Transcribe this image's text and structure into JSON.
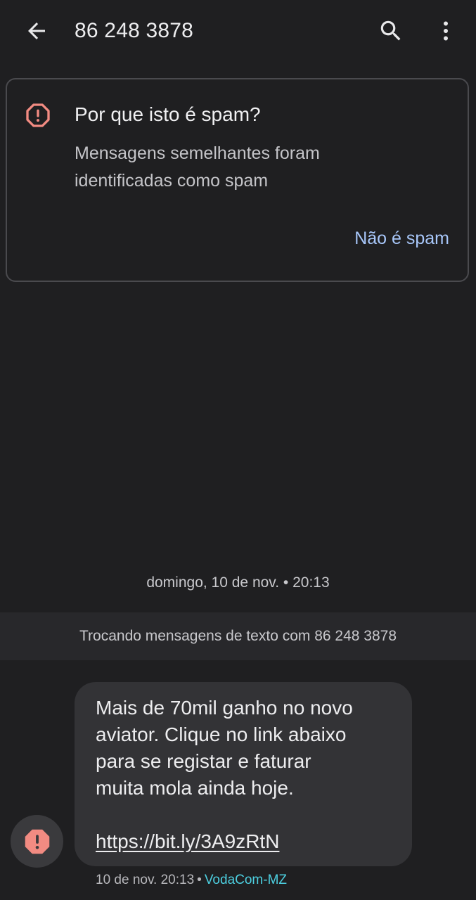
{
  "header": {
    "title": "86 248 3878",
    "back_icon": "arrow-left-icon",
    "search_icon": "search-icon",
    "more_icon": "more-vertical-icon"
  },
  "spam_card": {
    "title": "Por que isto é spam?",
    "description": "Mensagens semelhantes foram identificadas como spam",
    "not_spam_label": "Não é spam",
    "icon": "alert-octagon-icon"
  },
  "conversation": {
    "date_separator": "domingo, 10 de nov. • 20:13",
    "exchange_banner": "Trocando mensagens de texto com 86 248 3878"
  },
  "message": {
    "text": "Mais de 70mil ganho no novo\naviator. Clique no link abaixo\npara se registar e faturar\nmuita mola ainda hoje.",
    "link": "https://bit.ly/3A9zRtN",
    "timestamp": "10 de nov. 20:13",
    "separator": "•",
    "carrier": "VodaCom-MZ",
    "avatar_icon": "spam-alert-icon"
  },
  "colors": {
    "background": "#1f1f21",
    "accent_link": "#a8c7fa",
    "spam_red": "#f28b82",
    "carrier_cyan": "#4dd0e1"
  }
}
